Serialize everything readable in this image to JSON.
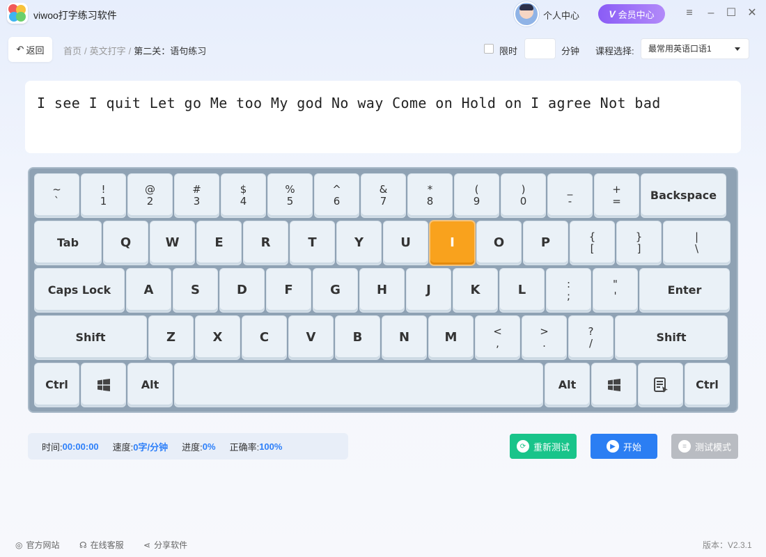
{
  "app": {
    "title": "viwoo打字练习软件"
  },
  "header": {
    "personal_center": "个人中心",
    "vip_badge": "V",
    "vip_label": "会员中心"
  },
  "toolbar": {
    "back_label": "返回",
    "breadcrumb": [
      "首页",
      "英文打字",
      "第二关：语句练习"
    ],
    "breadcrumb_sep": "/",
    "limit_label": "限时",
    "limit_checked": false,
    "minutes_value": "",
    "minutes_label": "分钟",
    "course_label": "课程选择:",
    "course_value": "最常用英语口语1"
  },
  "practice": {
    "text": "I see I quit Let go Me too My god No way Come on Hold on I agree Not bad"
  },
  "keyboard": {
    "highlight_key": "I",
    "rows": [
      [
        [
          "~",
          "`"
        ],
        [
          "!",
          "1"
        ],
        [
          "@",
          "2"
        ],
        [
          "#",
          "3"
        ],
        [
          "$",
          "4"
        ],
        [
          "%",
          "5"
        ],
        [
          "^",
          "6"
        ],
        [
          "&",
          "7"
        ],
        [
          "*",
          "8"
        ],
        [
          "(",
          "9"
        ],
        [
          ")",
          "0"
        ],
        [
          "_",
          "-"
        ],
        [
          "+",
          "="
        ],
        [
          "Backspace"
        ]
      ],
      [
        [
          "Tab"
        ],
        [
          "Q"
        ],
        [
          "W"
        ],
        [
          "E"
        ],
        [
          "R"
        ],
        [
          "T"
        ],
        [
          "Y"
        ],
        [
          "U"
        ],
        [
          "I"
        ],
        [
          "O"
        ],
        [
          "P"
        ],
        [
          "{",
          "["
        ],
        [
          "}",
          "]"
        ],
        [
          "|",
          "\\"
        ]
      ],
      [
        [
          "Caps Lock"
        ],
        [
          "A"
        ],
        [
          "S"
        ],
        [
          "D"
        ],
        [
          "F"
        ],
        [
          "G"
        ],
        [
          "H"
        ],
        [
          "J"
        ],
        [
          "K"
        ],
        [
          "L"
        ],
        [
          ":",
          ";"
        ],
        [
          "\"",
          "'"
        ],
        [
          "Enter"
        ]
      ],
      [
        [
          "Shift"
        ],
        [
          "Z"
        ],
        [
          "X"
        ],
        [
          "C"
        ],
        [
          "V"
        ],
        [
          "B"
        ],
        [
          "N"
        ],
        [
          "M"
        ],
        [
          "<",
          ","
        ],
        [
          ">",
          "."
        ],
        [
          "?",
          "/"
        ],
        [
          "Shift"
        ]
      ],
      [
        [
          "Ctrl"
        ],
        [
          "windows-icon"
        ],
        [
          "Alt"
        ],
        [
          ""
        ],
        [
          "Alt"
        ],
        [
          "windows-icon"
        ],
        [
          "menu-icon"
        ],
        [
          "Ctrl"
        ]
      ]
    ]
  },
  "stats": {
    "time_label": "时间:",
    "time_value": "00:00:00",
    "speed_label": "速度:",
    "speed_value": "0字/分钟",
    "progress_label": "进度:",
    "progress_value": "0%",
    "accuracy_label": "正确率:",
    "accuracy_value": "100%"
  },
  "actions": {
    "retest_label": "重新测试",
    "start_label": "开始",
    "testmode_label": "测试模式"
  },
  "footer": {
    "official_site": "官方网站",
    "online_service": "在线客服",
    "share": "分享软件",
    "version": "版本：V2.3.1"
  },
  "colors": {
    "accent": "#2b7ef3",
    "highlight": "#f9a21d",
    "retest": "#19c48a",
    "vip": "#8a5cf6"
  }
}
